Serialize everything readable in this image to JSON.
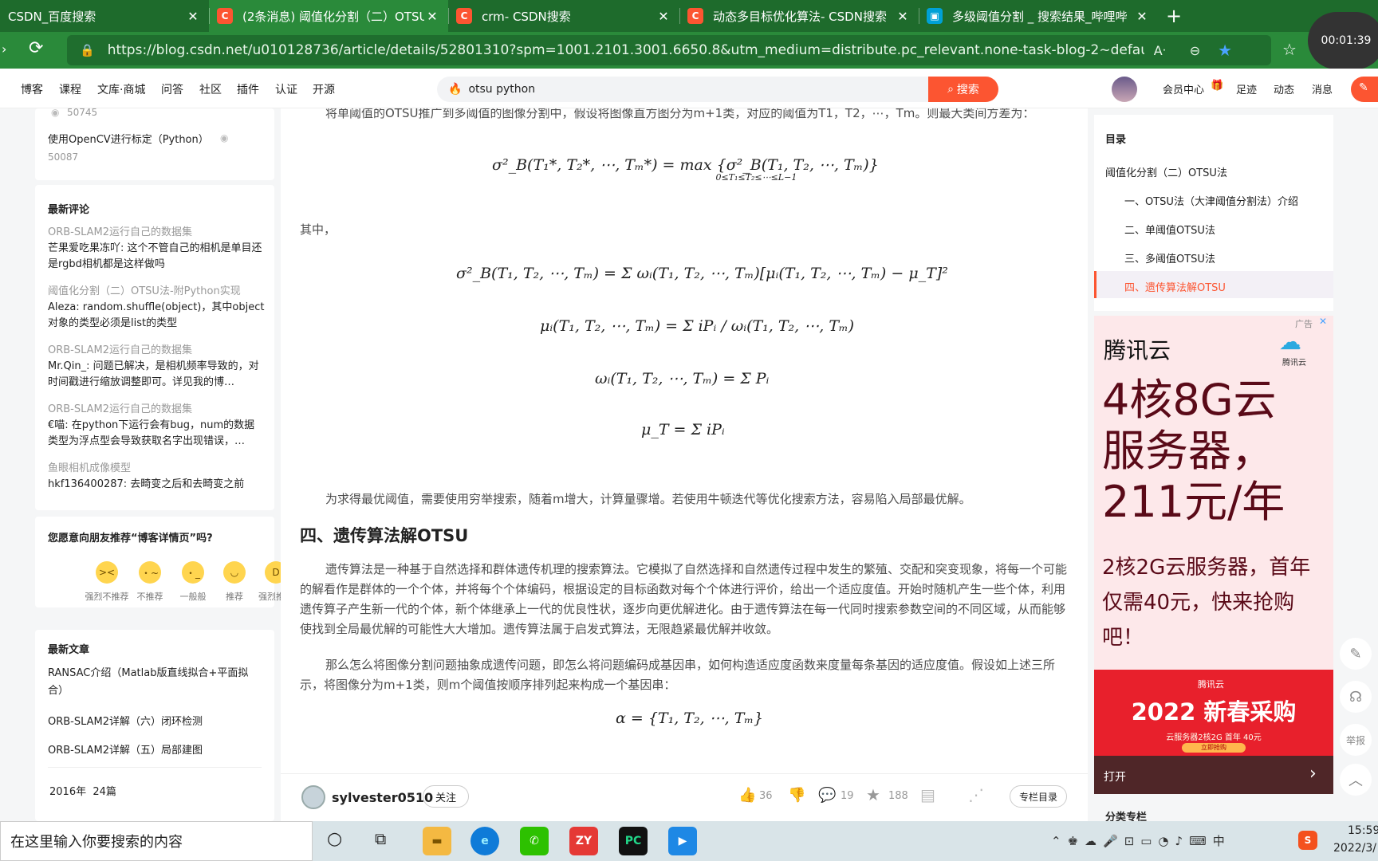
{
  "tabs": [
    {
      "title": "CSDN_百度搜索",
      "icon": "baidu-icon",
      "color": "#2a8a3a"
    },
    {
      "title": "(2条消息) 阈值化分割（二）OTSU",
      "icon": "csdn-icon",
      "color": "#fc5531"
    },
    {
      "title": "crm- CSDN搜索",
      "icon": "csdn-icon",
      "color": "#fc5531"
    },
    {
      "title": "动态多目标优化算法- CSDN搜索",
      "icon": "csdn-icon",
      "color": "#fc5531"
    },
    {
      "title": "多级阈值分割 _ 搜索结果_哔哩哔",
      "icon": "bilibili-icon",
      "color": "#00a1d6"
    }
  ],
  "address": {
    "url": "https://blog.csdn.net/u010128736/article/details/52801310?spm=1001.2101.3001.6650.8&utm_medium=distribute.pc_relevant.none-task-blog-2~default~BlogC...",
    "timer": "00:01:39"
  },
  "csdn_nav": {
    "links": [
      "博客",
      "课程",
      "文库·商城",
      "问答",
      "社区",
      "插件",
      "认证",
      "开源"
    ],
    "search_value": "otsu python",
    "search_button": "搜索",
    "right": [
      "会员中心",
      "足迹",
      "动态",
      "消息"
    ]
  },
  "sidebar": {
    "top_count": "50745",
    "top_article": "使用OpenCV进行标定（Python）",
    "top_article_count": "50087",
    "comments_title": "最新评论",
    "comments": [
      {
        "article": "ORB-SLAM2运行自己的数据集",
        "text": "芒果爱吃果冻吖: 这个不管自己的相机是单目还是rgbd相机都是这样做吗"
      },
      {
        "article": "阈值化分割（二）OTSU法-附Python实现",
        "text": "Aleza: random.shuffle(object)，其中object对象的类型必须是list的类型"
      },
      {
        "article": "ORB-SLAM2运行自己的数据集",
        "text": "Mr.Qin_: 问题已解决，是相机频率导致的，对时间戳进行缩放调整即可。详见我的博…"
      },
      {
        "article": "ORB-SLAM2运行自己的数据集",
        "text": "€喵: 在python下运行会有bug，num的数据类型为浮点型会导致获取名字出现错误，…"
      },
      {
        "article": "鱼眼相机成像模型",
        "text": "hkf136400287: 去畸变之后和去畸变之前"
      }
    ],
    "recommend_question": "您愿意向朋友推荐“博客详情页”吗?",
    "ratings": [
      "强烈不推荐",
      "不推荐",
      "一般般",
      "推荐",
      "强烈推荐"
    ],
    "recent_title": "最新文章",
    "recent": [
      "RANSAC介绍（Matlab版直线拟合+平面拟合）",
      "ORB-SLAM2详解（六）闭环检测",
      "ORB-SLAM2详解（五）局部建图"
    ],
    "archive": "2016年  24篇"
  },
  "article": {
    "intro": "将单阈值的OTSU推广到多阈值的图像分割中，假设将图像直方图分为m+1类，对应的阈值为T1，T2，⋯，Tm。则最大类间方差为：",
    "eq_max": "σ²_B(T₁*, T₂*, ⋯, Tₘ*) = max {σ²_B(T₁, T₂, ⋯, Tₘ)}",
    "eq_max_sub": "0≤T₁≤T₂≤⋯≤L−1",
    "where": "其中，",
    "eq1": "σ²_B(T₁, T₂, ⋯, Tₘ) = Σ ωᵢ(T₁, T₂, ⋯, Tₘ)[μᵢ(T₁, T₂, ⋯, Tₘ) − μ_T]²",
    "eq2": "μᵢ(T₁, T₂, ⋯, Tₘ) = Σ iPᵢ / ωᵢ(T₁, T₂, ⋯, Tₘ)",
    "eq3": "ωᵢ(T₁, T₂, ⋯, Tₘ) = Σ Pᵢ",
    "eq4": "μ_T = Σ iPᵢ",
    "para1": "为求得最优阈值，需要使用穷举搜索，随着m增大，计算量骤增。若使用牛顿迭代等优化搜索方法，容易陷入局部最优解。",
    "heading": "四、遗传算法解OTSU",
    "para2": "遗传算法是一种基于自然选择和群体遗传机理的搜索算法。它模拟了自然选择和自然遗传过程中发生的繁殖、交配和突变现象，将每一个可能的解看作是群体的一个个体，并将每个个体编码，根据设定的目标函数对每个个体进行评价，给出一个适应度值。开始时随机产生一些个体，利用遗传算子产生新一代的个体，新个体继承上一代的优良性状，逐步向更优解进化。由于遗传算法在每一代同时搜索参数空间的不同区域，从而能够使找到全局最优解的可能性大大增加。遗传算法属于启发式算法，无限趋紧最优解并收敛。",
    "para3": "那么怎么将图像分割问题抽象成遗传问题，即怎么将问题编码成基因串，如何构造适应度函数来度量每条基因的适应度值。假设如上述三所示，将图像分为m+1类，则m个阈值按顺序排列起来构成一个基因串：",
    "eq5": "α = {T₁, T₂, ⋯, Tₘ}"
  },
  "toolbar": {
    "author": "sylvester0510",
    "follow": "关注",
    "likes": "36",
    "comments": "19",
    "stars": "188",
    "column": "专栏目录"
  },
  "toc": {
    "title": "目录",
    "items": [
      {
        "label": "阈值化分割（二）OTSU法",
        "level": 1,
        "active": false
      },
      {
        "label": "一、OTSU法（大津阈值分割法）介绍",
        "level": 2,
        "active": false
      },
      {
        "label": "二、单阈值OTSU法",
        "level": 2,
        "active": false
      },
      {
        "label": "三、多阈值OTSU法",
        "level": 2,
        "active": false
      },
      {
        "label": "四、遗传算法解OTSU",
        "level": 2,
        "active": true
      }
    ]
  },
  "ad": {
    "tag": "广告",
    "brand": "腾讯云",
    "logo_text": "腾讯云",
    "big": "4核8G云服务器，211元/年",
    "small": "2核2G云服务器，首年仅需40元，快来抢购吧！",
    "banner_logo": "腾讯云",
    "banner_title": "2022 新春采购",
    "banner_sub": "云服务器2核2G 首年 40元",
    "banner_btn": "立即抢购",
    "open": "打开",
    "category": "分类专栏"
  },
  "float_tools": [
    "举报"
  ],
  "taskbar": {
    "search": "在这里输入你要搜索的内容",
    "time": "15:59",
    "date": "2022/3/"
  }
}
